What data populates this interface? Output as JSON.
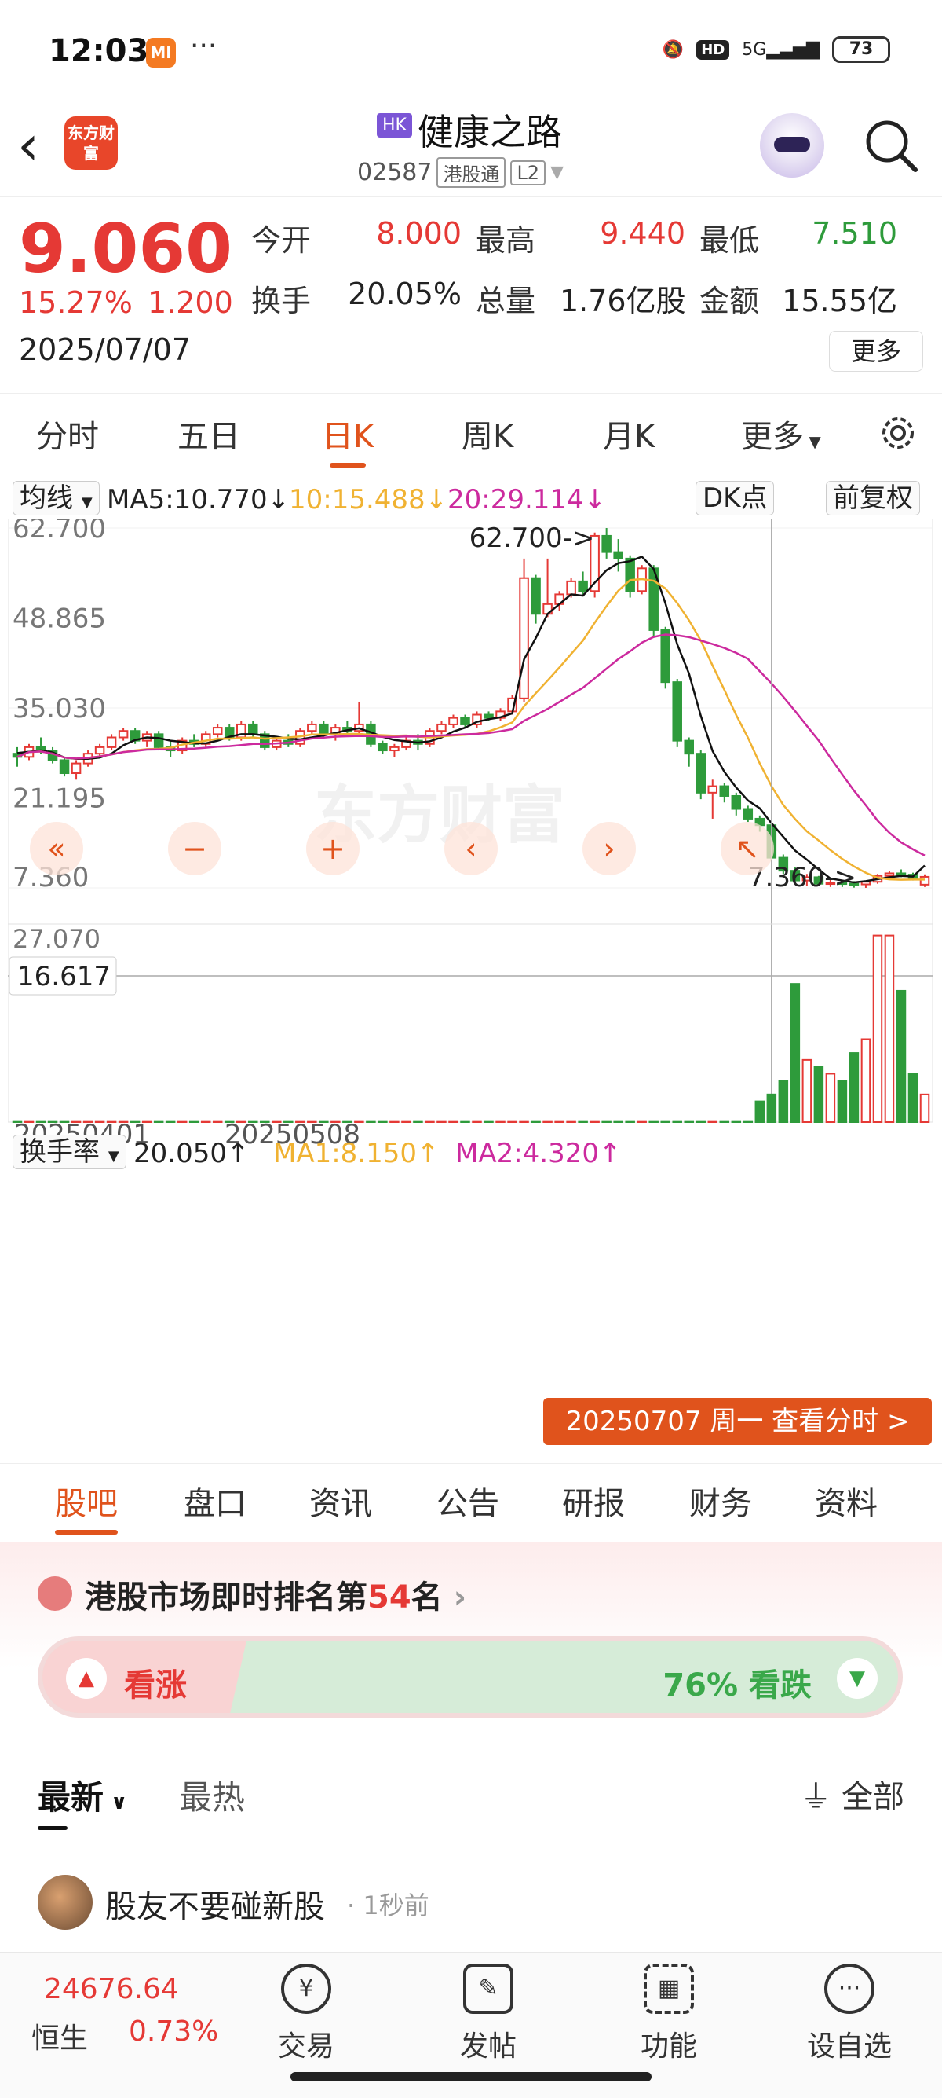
{
  "status": {
    "time": "12:03",
    "mi_label": "MI",
    "battery": "73",
    "network": "5G",
    "hd": "HD"
  },
  "header": {
    "logo_text": "东方财富",
    "market_badge": "HK",
    "stock_name": "健康之路",
    "code": "02587",
    "tag1": "港股通",
    "tag2": "L2"
  },
  "quote": {
    "price": "9.060",
    "change_pct": "15.27%",
    "change": "1.200",
    "date": "2025/07/07",
    "open_label": "今开",
    "open": "8.000",
    "high_label": "最高",
    "high": "9.440",
    "low_label": "最低",
    "low": "7.510",
    "turnover_label": "换手",
    "turnover": "20.05%",
    "volume_label": "总量",
    "volume": "1.76亿股",
    "amount_label": "金额",
    "amount": "15.55亿",
    "more": "更多"
  },
  "period_tabs": [
    {
      "label": "分时"
    },
    {
      "label": "五日"
    },
    {
      "label": "日K"
    },
    {
      "label": "周K"
    },
    {
      "label": "月K"
    },
    {
      "label": "更多"
    }
  ],
  "active_period": "日K",
  "ma_row": {
    "indicator": "均线",
    "ma5": "MA5:10.770",
    "ma10": "10:15.488",
    "ma20": "20:29.114",
    "dk": "DK点",
    "adjust": "前复权"
  },
  "vol_row": {
    "indicator": "换手率",
    "value": "20.050",
    "ma1": "MA1:8.150",
    "ma2": "MA2:4.320"
  },
  "colors": {
    "up": "#e53935",
    "down": "#2e9b3b",
    "ma5": "#111111",
    "ma10": "#f0b232",
    "ma20": "#cc2a9e",
    "accent": "#e0531c"
  },
  "chart_data": {
    "type": "candlestick",
    "y_ticks": [
      "62.700",
      "48.865",
      "35.030",
      "21.195",
      "7.360"
    ],
    "ylim": [
      7.36,
      62.7
    ],
    "max_label": "62.700",
    "min_label": "7.360",
    "crosshair_value": "16.617",
    "vol_y_ticks": [
      "27.070"
    ],
    "x_labels": [
      "20250401",
      "20250508"
    ],
    "selected_date_label": "20250707 周一 查看分时 >",
    "watermark": "东方财富",
    "candles": [
      [
        28.0,
        29.0,
        26.0,
        27.5
      ],
      [
        27.5,
        29.5,
        27.0,
        29.0
      ],
      [
        29.0,
        30.5,
        28.0,
        28.5
      ],
      [
        28.5,
        29.0,
        26.5,
        27.0
      ],
      [
        27.0,
        27.5,
        24.5,
        25.0
      ],
      [
        25.0,
        27.0,
        24.0,
        26.5
      ],
      [
        26.5,
        28.5,
        26.0,
        28.0
      ],
      [
        28.0,
        29.5,
        27.5,
        29.0
      ],
      [
        29.0,
        31.0,
        28.5,
        30.5
      ],
      [
        30.5,
        32.0,
        30.0,
        31.5
      ],
      [
        31.5,
        32.0,
        29.5,
        30.0
      ],
      [
        30.0,
        31.5,
        29.0,
        31.0
      ],
      [
        31.0,
        31.5,
        28.5,
        29.0
      ],
      [
        29.0,
        30.0,
        27.5,
        28.5
      ],
      [
        28.5,
        30.5,
        28.0,
        30.0
      ],
      [
        30.0,
        31.0,
        29.0,
        29.5
      ],
      [
        29.5,
        31.5,
        29.0,
        31.0
      ],
      [
        31.0,
        32.5,
        30.5,
        32.0
      ],
      [
        32.0,
        32.5,
        30.0,
        30.5
      ],
      [
        30.5,
        33.0,
        30.0,
        32.5
      ],
      [
        32.5,
        33.0,
        30.5,
        31.0
      ],
      [
        31.0,
        31.5,
        28.5,
        29.0
      ],
      [
        29.0,
        30.5,
        28.5,
        30.0
      ],
      [
        30.0,
        31.0,
        29.0,
        29.5
      ],
      [
        29.5,
        32.0,
        29.0,
        31.5
      ],
      [
        31.5,
        33.0,
        31.0,
        32.5
      ],
      [
        32.5,
        33.0,
        30.5,
        31.0
      ],
      [
        31.0,
        32.5,
        30.0,
        32.0
      ],
      [
        32.0,
        33.0,
        31.0,
        31.5
      ],
      [
        31.5,
        36.0,
        31.0,
        32.5
      ],
      [
        32.5,
        33.0,
        29.0,
        29.5
      ],
      [
        29.5,
        30.0,
        28.0,
        28.5
      ],
      [
        28.5,
        29.5,
        27.5,
        29.0
      ],
      [
        29.0,
        30.5,
        28.5,
        30.0
      ],
      [
        30.0,
        31.0,
        28.5,
        29.5
      ],
      [
        29.5,
        32.0,
        29.0,
        31.5
      ],
      [
        31.5,
        33.0,
        31.0,
        32.5
      ],
      [
        32.5,
        34.0,
        32.0,
        33.5
      ],
      [
        33.5,
        34.0,
        32.0,
        32.5
      ],
      [
        32.5,
        34.5,
        32.0,
        34.0
      ],
      [
        34.0,
        34.5,
        33.0,
        33.5
      ],
      [
        33.5,
        35.0,
        33.0,
        34.5
      ],
      [
        34.5,
        37.0,
        34.0,
        36.5
      ],
      [
        36.5,
        58.0,
        36.0,
        55.0
      ],
      [
        55.0,
        55.5,
        48.0,
        49.5
      ],
      [
        49.5,
        58.0,
        49.0,
        51.0
      ],
      [
        51.0,
        53.0,
        50.0,
        52.5
      ],
      [
        52.5,
        55.0,
        52.0,
        54.5
      ],
      [
        54.5,
        56.0,
        52.5,
        53.0
      ],
      [
        53.0,
        62.0,
        52.0,
        61.5
      ],
      [
        61.5,
        62.7,
        58.0,
        59.0
      ],
      [
        59.0,
        61.0,
        56.0,
        58.0
      ],
      [
        58.0,
        58.5,
        52.0,
        53.0
      ],
      [
        53.0,
        57.0,
        52.5,
        56.5
      ],
      [
        56.5,
        57.0,
        46.0,
        47.0
      ],
      [
        47.0,
        47.5,
        38.0,
        39.0
      ],
      [
        39.0,
        39.5,
        29.0,
        30.0
      ],
      [
        30.0,
        30.5,
        26.0,
        28.0
      ],
      [
        28.0,
        28.5,
        21.0,
        22.0
      ],
      [
        22.0,
        24.0,
        18.0,
        23.0
      ],
      [
        23.0,
        23.5,
        20.5,
        21.5
      ],
      [
        21.5,
        22.0,
        18.5,
        19.5
      ],
      [
        19.5,
        20.0,
        17.5,
        18.0
      ],
      [
        18.0,
        18.5,
        16.0,
        17.0
      ],
      [
        17.0,
        17.5,
        11.5,
        12.0
      ],
      [
        12.0,
        12.5,
        9.5,
        10.0
      ],
      [
        10.0,
        10.5,
        8.0,
        8.5
      ],
      [
        8.5,
        9.5,
        7.6,
        9.0
      ],
      [
        9.0,
        9.2,
        7.7,
        8.0
      ],
      [
        8.0,
        8.6,
        7.5,
        8.2
      ],
      [
        8.2,
        8.5,
        7.5,
        8.0
      ],
      [
        8.0,
        8.4,
        7.4,
        7.9
      ],
      [
        7.9,
        8.5,
        7.36,
        8.3
      ],
      [
        8.3,
        9.5,
        8.0,
        9.2
      ],
      [
        9.2,
        10.0,
        8.8,
        9.6
      ],
      [
        9.6,
        10.2,
        9.0,
        9.4
      ],
      [
        9.4,
        9.7,
        8.5,
        8.8
      ],
      [
        7.86,
        9.44,
        7.51,
        9.06
      ]
    ],
    "ma5": [
      28.1,
      28.3,
      28.5,
      28.2,
      27.4,
      27.2,
      27.2,
      27.4,
      28.0,
      29.3,
      30.1,
      30.5,
      30.4,
      30.0,
      29.8,
      29.6,
      29.6,
      30.0,
      30.6,
      31.0,
      31.0,
      30.8,
      30.6,
      30.3,
      30.2,
      30.5,
      30.8,
      31.2,
      31.6,
      31.9,
      31.3,
      30.6,
      30.1,
      29.9,
      29.7,
      29.9,
      30.5,
      31.4,
      32.0,
      32.9,
      33.3,
      33.6,
      34.2,
      42.5,
      45.8,
      49.5,
      51.0,
      52.5,
      52.3,
      54.3,
      56.2,
      57.3,
      57.6,
      58.3,
      56.4,
      51.1,
      44.8,
      40.3,
      33.8,
      28.4,
      25.2,
      22.8,
      20.8,
      19.6,
      17.3,
      15.2,
      13.1,
      11.7,
      10.2,
      8.8,
      8.5,
      8.2,
      8.4,
      8.7,
      9.0,
      9.2,
      9.1,
      10.8
    ]
  },
  "section_tabs": [
    {
      "label": "股吧"
    },
    {
      "label": "盘口"
    },
    {
      "label": "资讯"
    },
    {
      "label": "公告"
    },
    {
      "label": "研报"
    },
    {
      "label": "财务"
    },
    {
      "label": "资料"
    }
  ],
  "rank": {
    "prefix": "港股市场即时排名第",
    "number": "54",
    "suffix": "名"
  },
  "sentiment": {
    "up_label": "看涨",
    "down_label": "76% 看跌",
    "down_pct": 76
  },
  "feed": {
    "tab_latest": "最新",
    "tab_hot": "最热",
    "filter": "全部"
  },
  "post": {
    "author": "股友不要碰新股",
    "time": "· 1秒前"
  },
  "bottom": {
    "index_value": "24676.64",
    "index_name": "恒生",
    "index_change": "0.73%",
    "items": [
      {
        "label": "交易",
        "icon": "yen-icon"
      },
      {
        "label": "发帖",
        "icon": "edit-icon"
      },
      {
        "label": "功能",
        "icon": "grid-icon"
      },
      {
        "label": "设自选",
        "icon": "more-icon"
      }
    ]
  }
}
